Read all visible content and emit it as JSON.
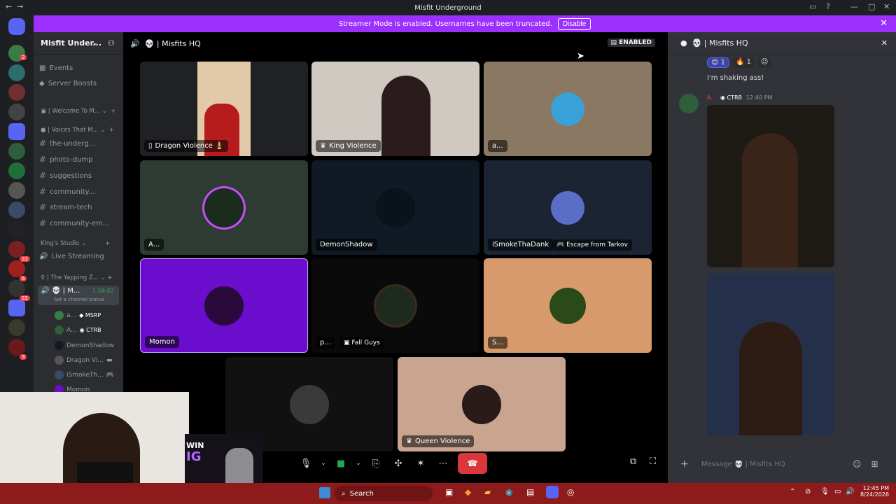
{
  "window": {
    "title": "Misfit Underground"
  },
  "banner": {
    "text": "Streamer Mode is enabled. Usernames have been truncated.",
    "disable": "Disable"
  },
  "rail": {
    "badges": [
      "2",
      "22",
      "6",
      "22",
      "3"
    ]
  },
  "server": {
    "name": "Misfit Under...",
    "items": [
      {
        "label": "Events",
        "icon": "calendar-icon"
      },
      {
        "label": "Server Boosts",
        "icon": "boost-icon"
      }
    ],
    "categories": [
      {
        "label": "Welcome To M..."
      },
      {
        "label": "Voices That M..."
      },
      {
        "label": "King's Studio"
      },
      {
        "label": "The Yapping Z..."
      }
    ],
    "channels": [
      "the-underg...",
      "photo-dump",
      "suggestions",
      "community...",
      "stream-tech",
      "community-em..."
    ],
    "live": "Live Streaming",
    "voice": {
      "name": "M...",
      "timer": "1:58:02",
      "status": "Set a channel status",
      "users": [
        {
          "name": "a...",
          "tag": "MSRP"
        },
        {
          "name": "A...",
          "tag": "CTRB"
        },
        {
          "name": "DemonShadow"
        },
        {
          "name": "Dragon Vi..."
        },
        {
          "name": "iSmokeTh..."
        },
        {
          "name": "Momon"
        }
      ]
    }
  },
  "stage": {
    "title": "Misfits HQ",
    "enabled": "ENABLED",
    "tiles": [
      {
        "name": "Dragon Violence 🎍",
        "bg": "#1f2124"
      },
      {
        "name": "King Violence",
        "bg": "#cfc9c2"
      },
      {
        "name": "a...",
        "bg": "#8b7862"
      },
      {
        "name": "A...",
        "bg": "#2d3b32"
      },
      {
        "name": "DemonShadow",
        "bg": "#0f1a24"
      },
      {
        "name": "iSmokeThaDank",
        "activity": "Escape from Tarkov",
        "bg": "#1a2432"
      },
      {
        "name": "Momon",
        "bg": "#6a0dcc"
      },
      {
        "name": "p...",
        "activity": "Fall Guys",
        "bg": "#0a0a0a"
      },
      {
        "name": "S...",
        "bg": "#d69a6c"
      },
      {
        "name": "",
        "bg": "#111111"
      },
      {
        "name": "Queen Violence",
        "bg": "#c9a48e"
      }
    ]
  },
  "chat": {
    "title": "Misfits HQ",
    "reactions": [
      {
        "emoji": "😊",
        "count": "1"
      },
      {
        "emoji": "🔥",
        "count": "1"
      }
    ],
    "message": "I'm shaking ass!",
    "author": "A...",
    "tag": "CTRB",
    "time": "12:40 PM",
    "placeholder": "Message 💀 | Misfits HQ"
  },
  "taskbar": {
    "search": "Search",
    "time": "12:45 PM",
    "date": "8/24/2026"
  },
  "promo": {
    "line1": "WIN",
    "line2": "IG"
  }
}
